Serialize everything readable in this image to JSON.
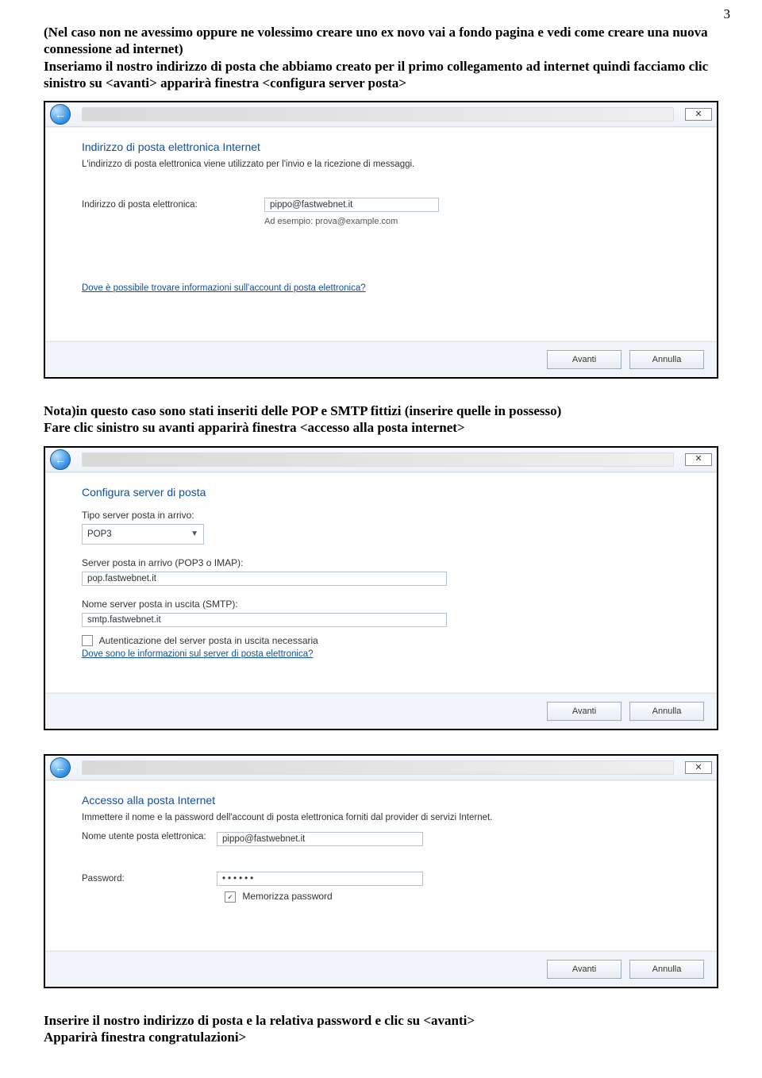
{
  "page_number": "3",
  "para1": "(Nel caso non ne avessimo oppure ne volessimo creare uno ex novo vai a fondo pagina e vedi come creare una nuova connessione ad internet)",
  "para2": "Inseriamo il nostro indirizzo di posta che abbiamo creato per il primo collegamento ad internet quindi facciamo clic sinistro su <avanti> apparirà finestra <configura server posta>",
  "para3a": "Nota)in questo caso sono stati inseriti delle POP e SMTP fittizi (inserire quelle in possesso)",
  "para3b": "Fare clic sinistro su avanti apparirà finestra  <accesso alla posta internet>",
  "para4a": "Inserire il nostro indirizzo di posta  e la relativa password e clic su <avanti>",
  "para4b": "Apparirà finestra congratulazioni>",
  "buttons": {
    "next": "Avanti",
    "cancel": "Annulla"
  },
  "win1": {
    "heading": "Indirizzo di posta elettronica Internet",
    "sub": "L'indirizzo di posta elettronica viene utilizzato per l'invio e la ricezione di messaggi.",
    "label_email": "Indirizzo di posta elettronica:",
    "value_email": "pippo@fastwebnet.it",
    "hint": "Ad esempio: prova@example.com",
    "link": "Dove è possibile trovare informazioni sull'account di posta elettronica?"
  },
  "win2": {
    "heading": "Configura server di posta",
    "label_type": "Tipo server posta in arrivo:",
    "value_type": "POP3",
    "label_in": "Server posta in arrivo (POP3 o IMAP):",
    "value_in": "pop.fastwebnet.it",
    "label_out": "Nome server posta in uscita (SMTP):",
    "value_out": "smtp.fastwebnet.it",
    "check_auth": "Autenticazione del server posta in uscita necessaria",
    "link": "Dove sono le informazioni sul server di posta elettronica?"
  },
  "win3": {
    "heading": "Accesso alla posta Internet",
    "sub": "Immettere il nome e la password dell'account di posta elettronica forniti dal provider di servizi Internet.",
    "label_user": "Nome utente posta elettronica:",
    "value_user": "pippo@fastwebnet.it",
    "label_pass": "Password:",
    "value_pass": "••••••",
    "check_remember": "Memorizza password"
  }
}
